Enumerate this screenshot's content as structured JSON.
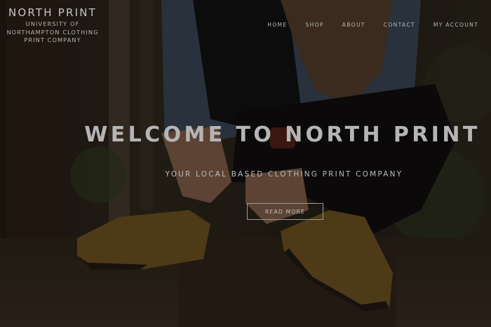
{
  "brand": {
    "title": "NORTH PRINT",
    "subtitle_line1": "UNIVERSITY OF",
    "subtitle_line2": "NORTHAMPTON CLOTHING",
    "subtitle_line3": "PRINT COMPANY"
  },
  "nav": {
    "items": [
      {
        "label": "HOME"
      },
      {
        "label": "SHOP"
      },
      {
        "label": "ABOUT"
      },
      {
        "label": "CONTACT"
      },
      {
        "label": "MY ACCOUNT"
      }
    ]
  },
  "hero": {
    "headline": "WELCOME TO NORTH PRINT",
    "tagline": "YOUR LOCAL BASED CLOTHING PRINT COMPANY",
    "cta_label": "READ MORE"
  },
  "colors": {
    "overlay": "#000000",
    "text": "#bcbcbc"
  }
}
